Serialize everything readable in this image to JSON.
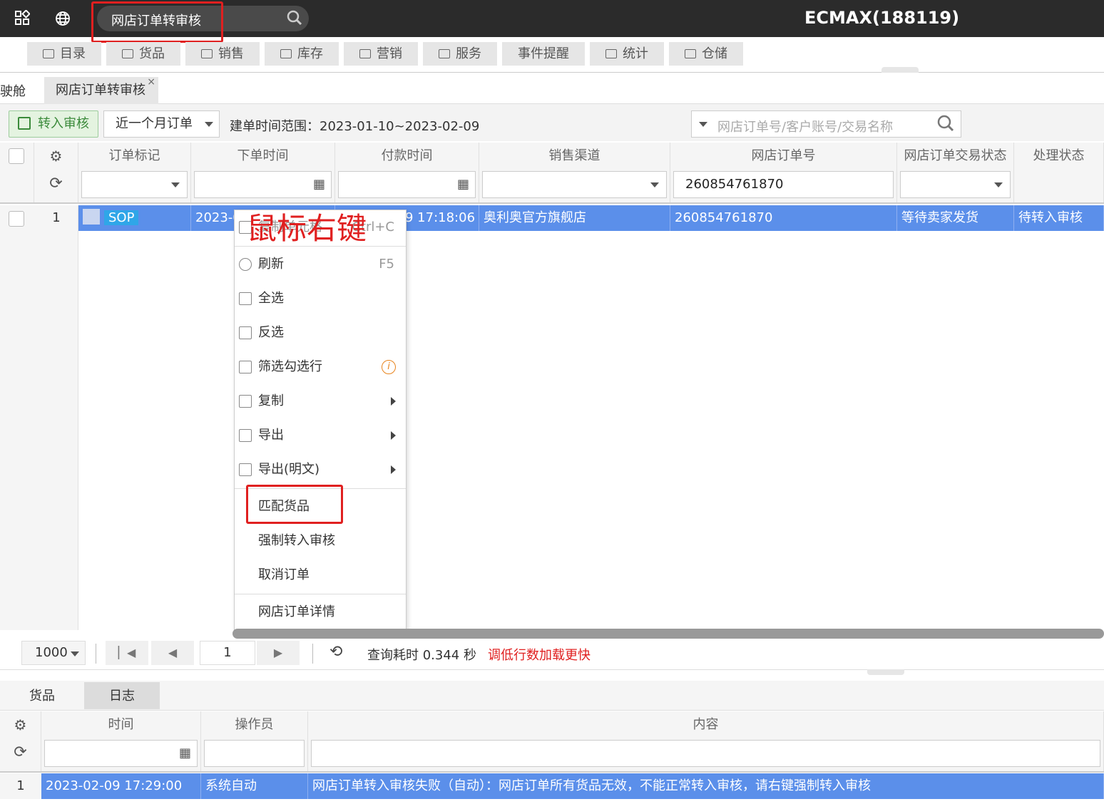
{
  "topbar": {
    "grid_icon": "grid-icon",
    "globe_icon": "globe-icon",
    "search_value": "网店订单转审核",
    "brand": "ECMAX(188119)"
  },
  "menu": [
    "目录",
    "货品",
    "销售",
    "库存",
    "营销",
    "服务",
    "事件提醒",
    "统计",
    "仓储"
  ],
  "tabs": {
    "first_partial": "驶舱",
    "active": "网店订单转审核",
    "close": "×"
  },
  "toolbar": {
    "to_review": "转入审核",
    "range_select": "近一个月订单",
    "range_label": "建单时间范围：2023-01-10~2023-02-09",
    "search_placeholder": "网店订单号/客户账号/交易名称"
  },
  "grid": {
    "headers": [
      "订单标记",
      "下单时间",
      "付款时间",
      "销售渠道",
      "网店订单号",
      "网店订单交易状态",
      "处理状态"
    ],
    "filter_order_no": "260854761870",
    "row": {
      "index": "1",
      "mark": "SOP",
      "order_time": "2023-0",
      "pay_time": "9 17:18:06",
      "channel": "奥利奥官方旗舰店",
      "order_no": "260854761870",
      "trade_status": "等待卖家发货",
      "process_status": "待转入审核"
    }
  },
  "context_menu": {
    "copy_cell": "复制单元格",
    "copy_cell_shortcut": "Ctrl+C",
    "refresh": "刷新",
    "refresh_shortcut": "F5",
    "select_all": "全选",
    "invert": "反选",
    "filter_check": "筛选勾选行",
    "copy": "复制",
    "export": "导出",
    "export_plain": "导出(明文)",
    "match_goods": "匹配货品",
    "force_review": "强制转入审核",
    "cancel_order": "取消订单",
    "order_detail": "网店订单详情"
  },
  "annotation": "鼠标右键",
  "pager": {
    "page_size": "1000",
    "page": "1",
    "query_time": "查询耗时 0.344 秒",
    "hint": "调低行数加载更快"
  },
  "bottom": {
    "tabs": [
      "货品",
      "日志"
    ],
    "headers": [
      "时间",
      "操作员",
      "内容"
    ],
    "row": {
      "index": "1",
      "time": "2023-02-09 17:29:00",
      "operator": "系统自动",
      "content": "网店订单转入审核失败（自动）：网店订单所有货品无效，不能正常转入审核，请右键强制转入审核"
    }
  },
  "colors": {
    "accent_row": "#5b8fea",
    "highlight_red": "#e02020",
    "topbar_bg": "#2b2b2b"
  }
}
